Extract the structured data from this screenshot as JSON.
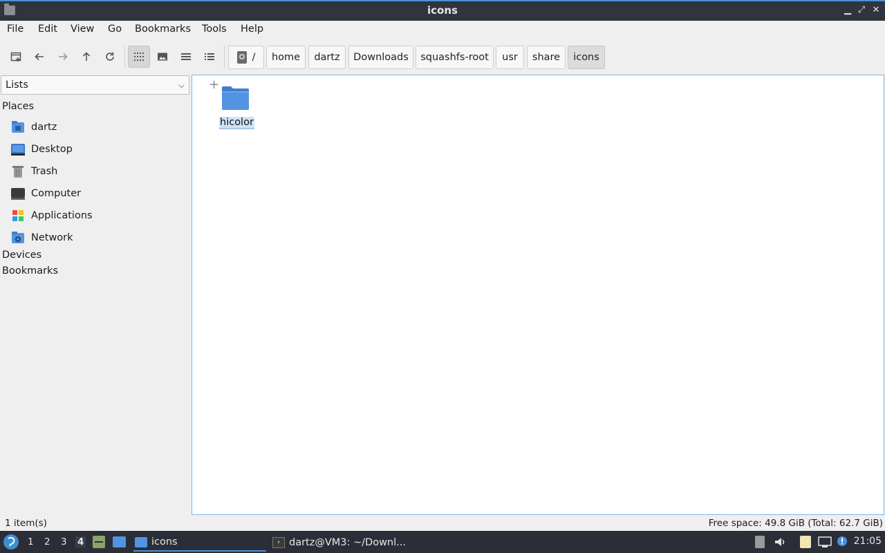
{
  "window": {
    "title": "icons"
  },
  "menu": [
    "File",
    "Edit",
    "View",
    "Go",
    "Bookmarks",
    "Tools",
    "Help"
  ],
  "breadcrumbs": [
    "/",
    "home",
    "dartz",
    "Downloads",
    "squashfs-root",
    "usr",
    "share",
    "icons"
  ],
  "sidebar": {
    "select_value": "Lists",
    "places_header": "Places",
    "places": [
      {
        "label": "dartz",
        "icon": "home-folder-icon"
      },
      {
        "label": "Desktop",
        "icon": "desktop-icon"
      },
      {
        "label": "Trash",
        "icon": "trash-icon"
      },
      {
        "label": "Computer",
        "icon": "computer-icon"
      },
      {
        "label": "Applications",
        "icon": "applications-icon"
      },
      {
        "label": "Network",
        "icon": "network-icon"
      }
    ],
    "devices_header": "Devices",
    "bookmarks_header": "Bookmarks"
  },
  "content": {
    "items": [
      {
        "name": "hicolor",
        "icon": "folder-icon",
        "selected": true
      }
    ]
  },
  "status": {
    "count": "1 item(s)",
    "free_space": "Free space: 49.8 GiB (Total: 62.7 GiB)"
  },
  "taskbar": {
    "workspaces": [
      "1",
      "2",
      "3",
      "4"
    ],
    "active_workspace": "4",
    "tasks": [
      {
        "label": "icons",
        "active": true
      },
      {
        "label": "dartz@VM3: ~/Downl..."
      }
    ],
    "clock": "21:05"
  },
  "colors": {
    "accent": "#4a90d9",
    "titlebar": "#2f343f",
    "taskbar": "#2b2e37",
    "folder": "#5294e2"
  }
}
